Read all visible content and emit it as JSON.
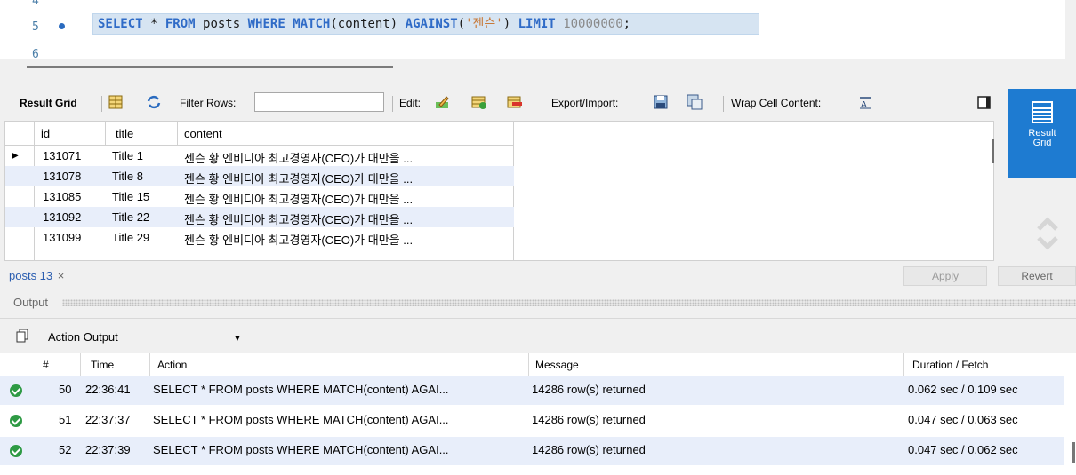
{
  "editor": {
    "lines": [
      {
        "num": "4"
      },
      {
        "num": "5"
      },
      {
        "num": "6"
      }
    ],
    "sql": {
      "t1": "SELECT",
      "t2": " * ",
      "t3": "FROM",
      "t4": " posts ",
      "t5": "WHERE",
      "t6": " ",
      "t7": "MATCH",
      "t8": "(content) ",
      "t9": "AGAINST",
      "t10": "(",
      "t11": "'젠슨'",
      "t12": ") ",
      "t13": "LIMIT",
      "t14": " ",
      "t15": "10000000",
      "t16": ";"
    }
  },
  "toolbar": {
    "result_grid": "Result Grid",
    "filter_rows": "Filter Rows:",
    "filter_value": "",
    "edit": "Edit:",
    "export_import": "Export/Import:",
    "wrap_cell": "Wrap Cell Content:"
  },
  "side": {
    "result_grid_label_1": "Result",
    "result_grid_label_2": "Grid"
  },
  "grid": {
    "columns": [
      "id",
      "title",
      "content"
    ],
    "rows": [
      {
        "id": "131071",
        "title": "Title 1",
        "content": "젠슨 황 엔비디아 최고경영자(CEO)가 대만을 ..."
      },
      {
        "id": "131078",
        "title": "Title 8",
        "content": "젠슨 황 엔비디아 최고경영자(CEO)가 대만을 ..."
      },
      {
        "id": "131085",
        "title": "Title 15",
        "content": "젠슨 황 엔비디아 최고경영자(CEO)가 대만을 ..."
      },
      {
        "id": "131092",
        "title": "Title 22",
        "content": "젠슨 황 엔비디아 최고경영자(CEO)가 대만을 ..."
      },
      {
        "id": "131099",
        "title": "Title 29",
        "content": "젠슨 황 엔비디아 최고경영자(CEO)가 대만을 ..."
      }
    ]
  },
  "tabs": {
    "active": "posts 13",
    "close": "×",
    "apply": "Apply",
    "revert": "Revert"
  },
  "output": {
    "title": "Output",
    "selector": "Action Output",
    "columns": [
      "#",
      "Time",
      "Action",
      "Message",
      "Duration / Fetch"
    ],
    "rows": [
      {
        "num": "50",
        "time": "22:36:41",
        "action": "SELECT * FROM posts WHERE MATCH(content) AGAI...",
        "message": "14286 row(s) returned",
        "duration": "0.062 sec / 0.109 sec"
      },
      {
        "num": "51",
        "time": "22:37:37",
        "action": "SELECT * FROM posts WHERE MATCH(content) AGAI...",
        "message": "14286 row(s) returned",
        "duration": "0.047 sec / 0.063 sec"
      },
      {
        "num": "52",
        "time": "22:37:39",
        "action": "SELECT * FROM posts WHERE MATCH(content) AGAI...",
        "message": "14286 row(s) returned",
        "duration": "0.047 sec / 0.062 sec"
      }
    ]
  },
  "colors": {
    "accent": "#1e7bd1",
    "keyword": "#2f6bc7",
    "string": "#c87a3a",
    "success": "#2e9a44",
    "row_alt": "#e8eefa"
  }
}
